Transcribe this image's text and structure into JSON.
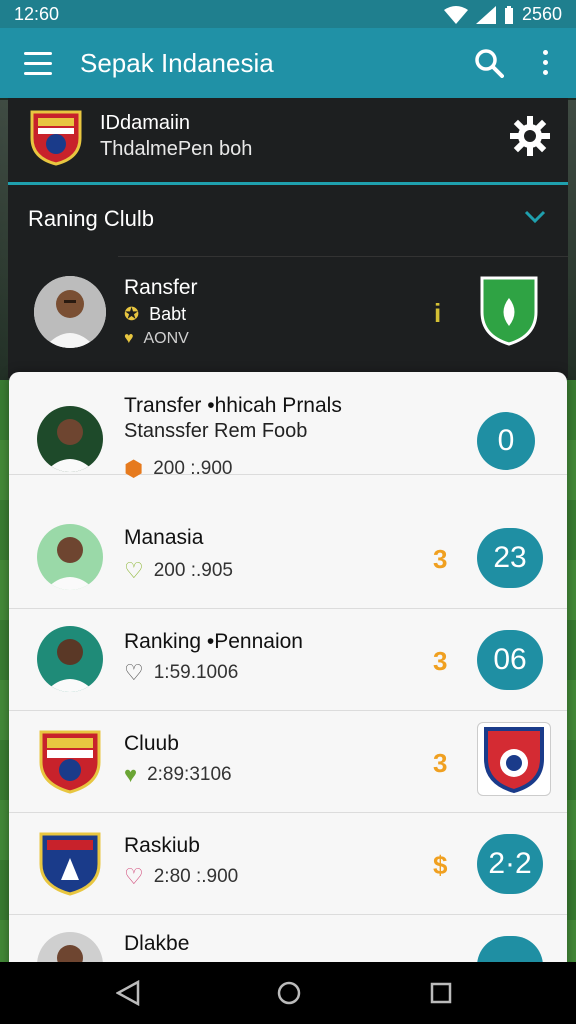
{
  "status_bar": {
    "time": "12:60",
    "battery": "2560"
  },
  "app_bar": {
    "title": "Sepak Indanesia"
  },
  "account": {
    "name": "IDdamaiin",
    "subtitle": "ThdalmePen boh"
  },
  "section": {
    "title": "Raning Clulb"
  },
  "featured": {
    "name": "Ransfer",
    "line1": "Babt",
    "line2": "AONV",
    "mark": "i"
  },
  "rows": [
    {
      "title": "Transfer •hhicah Prnals",
      "subtitle": "Stanssfer Rem Foob",
      "meta": "200 :.900",
      "mark": "",
      "badge": "0"
    },
    {
      "title": "Manasia",
      "meta": "200 :.905",
      "mark": "3",
      "badge": "23"
    },
    {
      "title": "Ranking •Pennaion",
      "meta": "1:59.1006",
      "mark": "3",
      "badge": "06"
    },
    {
      "title": "Cluub",
      "meta": "2:89:3106",
      "mark": "3",
      "badge": ""
    },
    {
      "title": "Raskiub",
      "meta": "2:80 :.900",
      "mark": "$",
      "badge": "2·2"
    },
    {
      "title": "Dlakbe",
      "meta": "",
      "mark": "",
      "badge": ""
    }
  ],
  "colors": {
    "accent": "#2091a6",
    "pill": "#1f8fa3",
    "mark": "#f0a020"
  }
}
